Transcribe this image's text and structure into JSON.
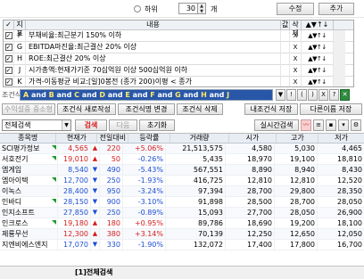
{
  "topbar": {
    "radio_label": "하위",
    "count_value": "30",
    "unit": "개",
    "edit_button": "수정",
    "add_button": "추가"
  },
  "conditions": {
    "headers": {
      "index": "지표",
      "content": "내용",
      "value": "값",
      "delete": "삭제",
      "actions": "▲▼↑↓"
    },
    "rows": [
      {
        "id": "F",
        "desc": "부채비율:최근분기 150% 이하",
        "x": "X",
        "act": "▲▼↑↓"
      },
      {
        "id": "G",
        "desc": "EBITDA마진율:최근결산 20% 이상",
        "x": "X",
        "act": "▲▼↑↓"
      },
      {
        "id": "H",
        "desc": "ROE:최근결산 20% 이상",
        "x": "X",
        "act": "▲▼↑↓"
      },
      {
        "id": "J",
        "desc": "시가총액:현재가기준 70십억원 이상 500십억원 이하",
        "x": "X",
        "act": "▲▼↑↓"
      },
      {
        "id": "K",
        "desc": "가격-이동평균 비교:[일]0봉전 (종가 200)이평 < 종가",
        "x": "X",
        "act": "▲▼↑↓"
      }
    ]
  },
  "formula": {
    "label": "조건식",
    "parts": [
      "A",
      " and ",
      "B",
      " and ",
      "C",
      " and ",
      "D",
      " and ",
      "E",
      " and ",
      "F",
      " and ",
      "G",
      " and ",
      "H",
      " and ",
      "J"
    ],
    "symbols": [
      "▼",
      "!",
      "(",
      ")",
      "X",
      "?"
    ]
  },
  "toolbar": {
    "items": [
      "수익설중 중소형",
      "조건식 새로작성",
      "조건식명 변경",
      "조건식 삭제",
      "내조건식 저장",
      "다른이름 저장"
    ]
  },
  "search": {
    "select_value": "전체검색",
    "search_button": "검색",
    "next_button": "다음",
    "reset_button": "초기화",
    "realtime_button": "실시간검색"
  },
  "grid": {
    "headers": [
      "종목명",
      "현재가",
      "전일대비",
      "등락률",
      "거래량",
      "시가",
      "고가",
      "저가"
    ],
    "rows": [
      {
        "name": "SCI평가정보",
        "price": "4,565",
        "arrow": "▲",
        "dir": "up",
        "diff": "220",
        "rate": "+5.06%",
        "vol": "21,513,575",
        "open": "4,580",
        "high": "5,030",
        "low": "4,465"
      },
      {
        "name": "서호전기",
        "price": "19,010",
        "arrow": "▲",
        "dir": "up",
        "diff": "50",
        "rate": "-0.26%",
        "vol": "5,435",
        "open": "18,970",
        "high": "19,100",
        "low": "18,810"
      },
      {
        "name": "엠게임",
        "price": "8,540",
        "arrow": "▼",
        "dir": "dn",
        "diff": "490",
        "rate": "-5.43%",
        "vol": "567,551",
        "open": "8,890",
        "high": "8,940",
        "low": "8,430"
      },
      {
        "name": "엠아이텍",
        "price": "12,700",
        "arrow": "▼",
        "dir": "dn",
        "diff": "250",
        "rate": "-1.93%",
        "vol": "416,725",
        "open": "12,810",
        "high": "12,810",
        "low": "12,520"
      },
      {
        "name": "이녹스",
        "price": "28,400",
        "arrow": "▼",
        "dir": "dn",
        "diff": "950",
        "rate": "-3.24%",
        "vol": "97,394",
        "open": "28,700",
        "high": "29,800",
        "low": "28,350"
      },
      {
        "name": "인바디",
        "price": "28,150",
        "arrow": "▼",
        "dir": "dn",
        "diff": "900",
        "rate": "-3.10%",
        "vol": "91,898",
        "open": "28,500",
        "high": "28,700",
        "low": "28,050"
      },
      {
        "name": "인지소프트",
        "price": "27,850",
        "arrow": "▼",
        "dir": "dn",
        "diff": "250",
        "rate": "-0.89%",
        "vol": "15,093",
        "open": "27,700",
        "high": "28,050",
        "low": "26,900"
      },
      {
        "name": "인크로스",
        "price": "19,180",
        "arrow": "▲",
        "dir": "up",
        "diff": "180",
        "rate": "+0.95%",
        "vol": "89,786",
        "open": "18,690",
        "high": "19,200",
        "low": "18,100"
      },
      {
        "name": "제룡무선",
        "price": "12,300",
        "arrow": "▲",
        "dir": "up",
        "diff": "380",
        "rate": "+3.14%",
        "vol": "70,139",
        "open": "12,250",
        "high": "12,650",
        "low": "12,050"
      },
      {
        "name": "지엔비에스엔지",
        "price": "17,070",
        "arrow": "▼",
        "dir": "dn",
        "diff": "330",
        "rate": "-1.90%",
        "vol": "132,072",
        "open": "17,400",
        "high": "17,800",
        "low": "16,700"
      }
    ]
  },
  "bottom": {
    "tab_label": "[1]전체검색"
  }
}
